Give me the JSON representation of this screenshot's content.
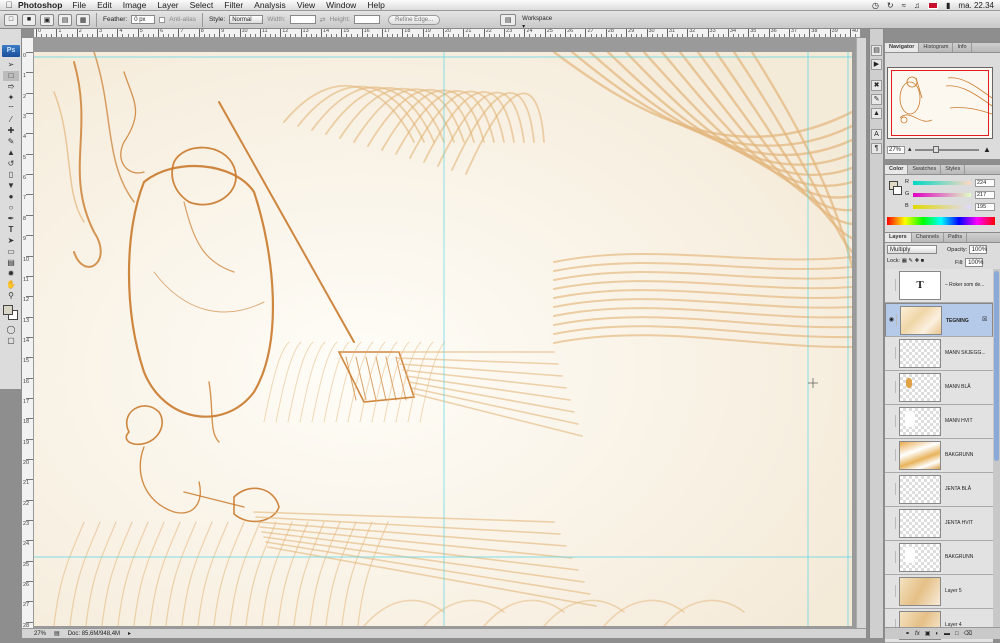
{
  "menubar": {
    "apple_icon": "apple-icon",
    "app_name": "Photoshop",
    "items": [
      "File",
      "Edit",
      "Image",
      "Layer",
      "Select",
      "Filter",
      "Analysis",
      "View",
      "Window",
      "Help"
    ],
    "clock": "ma. 22.34"
  },
  "options": {
    "feather_label": "Feather:",
    "feather_value": "0 px",
    "antialias_label": "Anti-alias",
    "style_label": "Style:",
    "style_value": "Normal",
    "width_label": "Width:",
    "height_label": "Height:",
    "refine_edge": "Refine Edge...",
    "workspace": "Workspace"
  },
  "tools": {
    "ps_logo": "Ps",
    "items": [
      "marquee",
      "move",
      "lasso",
      "wand",
      "crop",
      "slice",
      "heal",
      "brush",
      "stamp",
      "history",
      "eraser",
      "gradient",
      "blur",
      "dodge",
      "pen",
      "type",
      "path",
      "shape",
      "notes",
      "eyedrop",
      "hand",
      "zoom"
    ]
  },
  "ruler_h_labels": [
    "0",
    "1",
    "2",
    "3",
    "4",
    "5",
    "6",
    "7",
    "8",
    "9",
    "10",
    "11",
    "12",
    "13",
    "14",
    "15",
    "16",
    "17",
    "18",
    "19",
    "20",
    "21",
    "22",
    "23",
    "24",
    "25",
    "26",
    "27",
    "28",
    "29",
    "30",
    "31",
    "32",
    "33",
    "34",
    "35",
    "36",
    "37",
    "38",
    "39",
    "40"
  ],
  "ruler_v_labels": [
    "0",
    "1",
    "2",
    "3",
    "4",
    "5",
    "6",
    "7",
    "8",
    "9",
    "10",
    "11",
    "12",
    "13",
    "14",
    "15",
    "16",
    "17",
    "18",
    "19",
    "20",
    "21",
    "22",
    "23",
    "24",
    "25",
    "26",
    "27",
    "28"
  ],
  "status": {
    "zoom": "27%",
    "doc": "Doc: 85,6M/948,4M"
  },
  "navigator": {
    "tabs": [
      "Navigator",
      "Histogram",
      "Info"
    ],
    "zoom": "27%"
  },
  "color": {
    "tabs": [
      "Color",
      "Swatches",
      "Styles"
    ],
    "channels": [
      {
        "label": "R",
        "value": "224"
      },
      {
        "label": "G",
        "value": "217"
      },
      {
        "label": "B",
        "value": "195"
      }
    ],
    "foreground": "#e0d9c3"
  },
  "layers": {
    "tabs": [
      "Layers",
      "Channels",
      "Paths"
    ],
    "blend_mode": "Multiply",
    "opacity_label": "Opacity:",
    "opacity": "100%",
    "lock_label": "Lock:",
    "fill_label": "Fill:",
    "fill": "100%",
    "list": [
      {
        "name": "– Roker som de...",
        "kind": "text",
        "visible": false,
        "selected": false,
        "glyph": "T"
      },
      {
        "name": "TEGNING",
        "kind": "art",
        "visible": true,
        "selected": true
      },
      {
        "name": "MANN SKJEGG...",
        "kind": "empty",
        "visible": false,
        "selected": false
      },
      {
        "name": "MANN BLÅ",
        "kind": "blue",
        "visible": false,
        "selected": false
      },
      {
        "name": "MANN HVIT",
        "kind": "white",
        "visible": false,
        "selected": false
      },
      {
        "name": "BAKGRUNN",
        "kind": "bg",
        "visible": false,
        "selected": false
      },
      {
        "name": "JENTA BLÅ",
        "kind": "empty",
        "visible": false,
        "selected": false
      },
      {
        "name": "JENTA HVIT",
        "kind": "empty",
        "visible": false,
        "selected": false
      },
      {
        "name": "BAKGRUNN",
        "kind": "white",
        "visible": false,
        "selected": false
      },
      {
        "name": "Layer 5",
        "kind": "art2",
        "visible": false,
        "selected": false
      },
      {
        "name": "Layer 4",
        "kind": "art2",
        "visible": false,
        "selected": false
      }
    ]
  },
  "colors": {
    "sketch": "#c97a2c",
    "sketch_light": "#e3b57a",
    "paper": "#fdfaf3",
    "guide": "#5ad6e6"
  }
}
